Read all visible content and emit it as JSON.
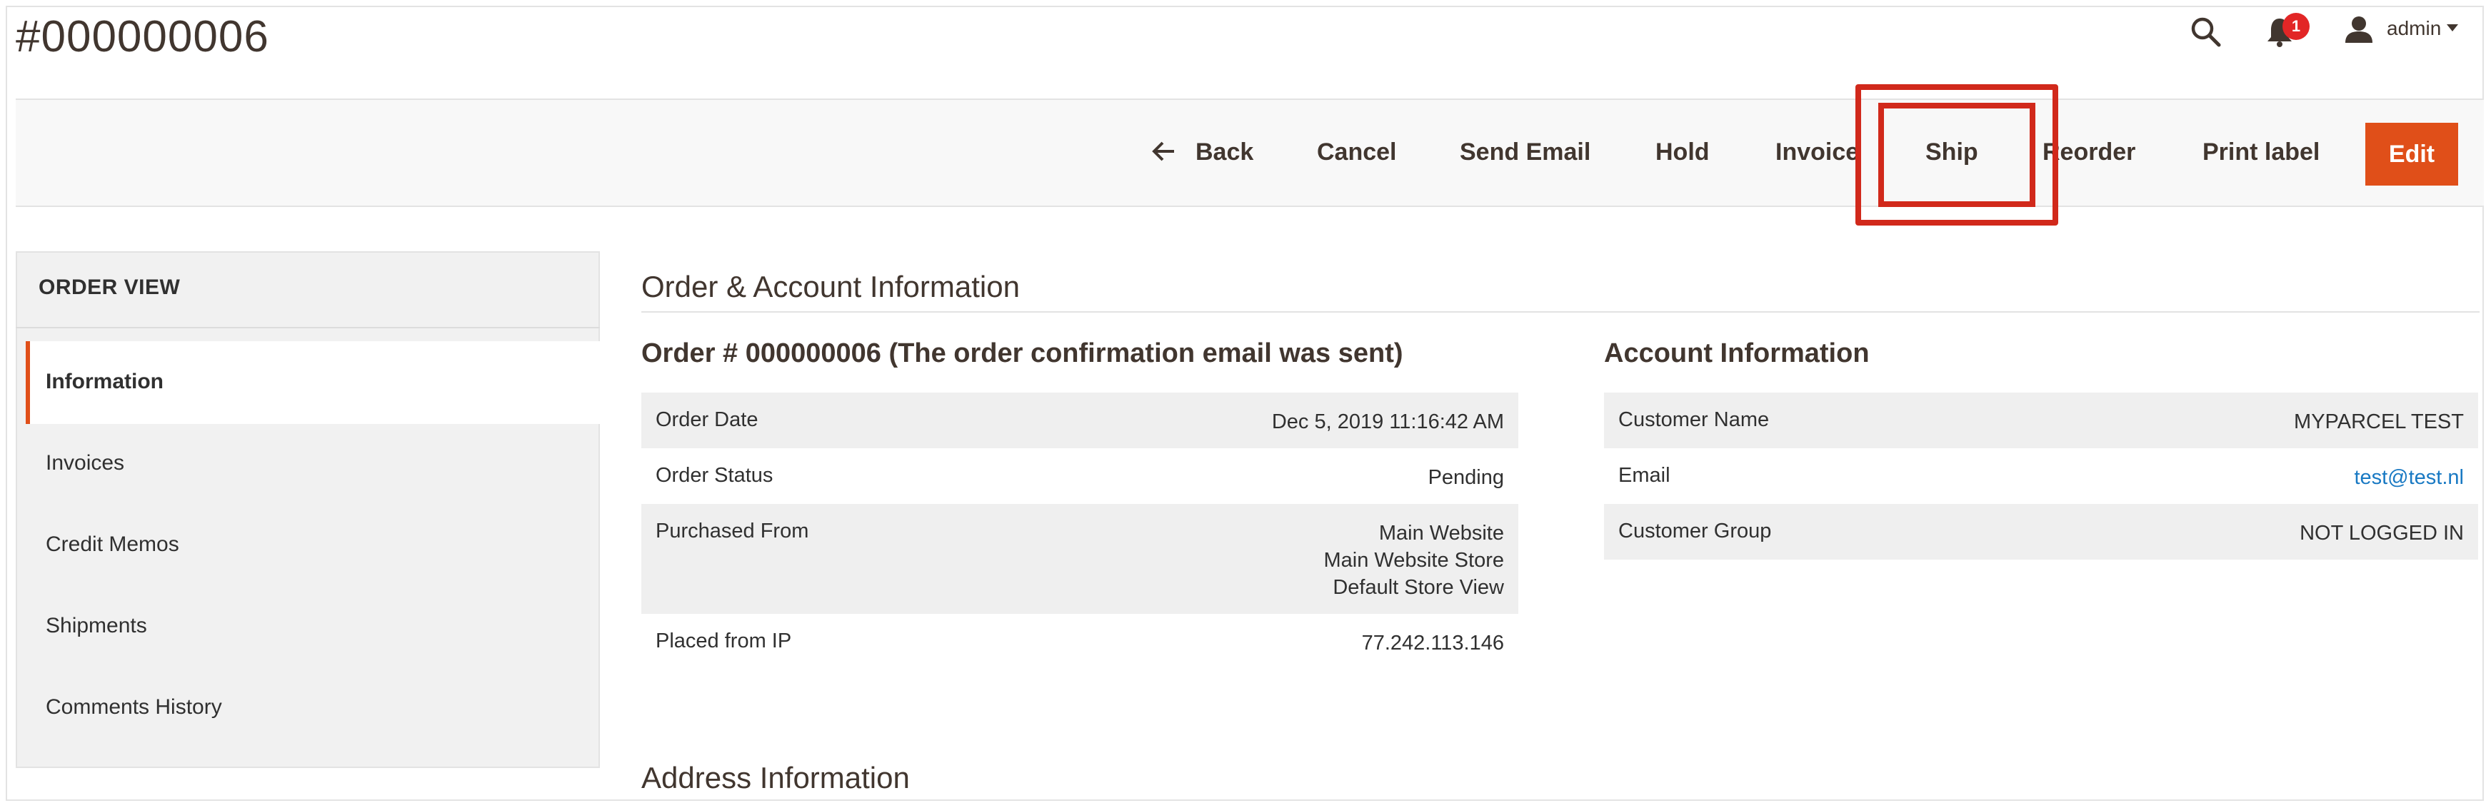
{
  "page": {
    "title": "#000000006"
  },
  "topbar": {
    "notification_count": "1",
    "user_name": "admin"
  },
  "toolbar": {
    "back": "Back",
    "cancel": "Cancel",
    "send_email": "Send Email",
    "hold": "Hold",
    "invoice": "Invoice",
    "ship": "Ship",
    "reorder": "Reorder",
    "print_label": "Print label",
    "edit": "Edit"
  },
  "sidebar": {
    "title": "ORDER VIEW",
    "items": [
      {
        "label": "Information",
        "active": true
      },
      {
        "label": "Invoices"
      },
      {
        "label": "Credit Memos"
      },
      {
        "label": "Shipments"
      },
      {
        "label": "Comments History"
      }
    ]
  },
  "main": {
    "section_title": "Order & Account Information",
    "order": {
      "title": "Order # 000000006 (The order confirmation email was sent)",
      "rows": [
        {
          "label": "Order Date",
          "value": "Dec 5, 2019 11:16:42 AM"
        },
        {
          "label": "Order Status",
          "value": "Pending"
        },
        {
          "label": "Purchased From",
          "value_lines": [
            "Main Website",
            "Main Website Store",
            "Default Store View"
          ]
        },
        {
          "label": "Placed from IP",
          "value": "77.242.113.146"
        }
      ]
    },
    "account": {
      "title": "Account Information",
      "rows": [
        {
          "label": "Customer Name",
          "value": "MYPARCEL TEST"
        },
        {
          "label": "Email",
          "value": "test@test.nl"
        },
        {
          "label": "Customer Group",
          "value": "NOT LOGGED IN"
        }
      ]
    },
    "address_title": "Address Information"
  },
  "colors": {
    "accent": "#e04f19",
    "highlight": "#d1291b",
    "link": "#1979c3",
    "badge": "#e22626"
  },
  "icons": [
    "search-icon",
    "bell-icon",
    "user-icon",
    "chevron-down-icon",
    "arrow-left-icon"
  ]
}
